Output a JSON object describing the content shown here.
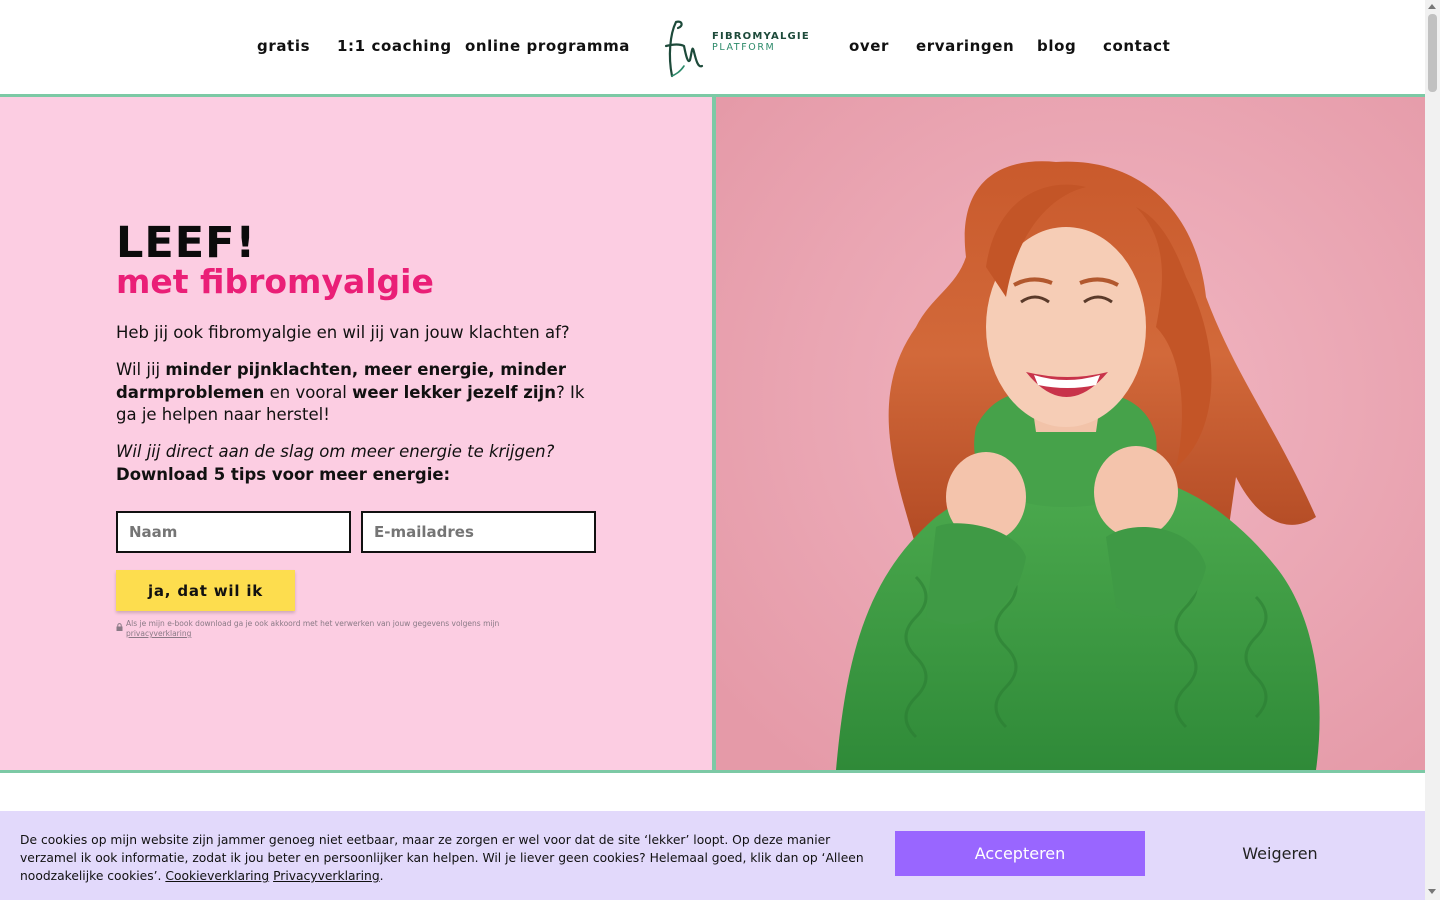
{
  "nav": {
    "left": [
      "gratis",
      "1:1 coaching",
      "online programma"
    ],
    "right": [
      "over",
      "ervaringen",
      "blog",
      "contact"
    ]
  },
  "logo": {
    "line1": "FIBROMYALGIE",
    "line2": "PLATFORM"
  },
  "hero": {
    "title": "LEEF!",
    "subtitle": "met fibromyalgie",
    "intro": "Heb jij ook fibromyalgie en wil jij van jouw klachten af?",
    "p2": {
      "a": "Wil jij ",
      "b": "minder pijnklachten, meer energie, minder darmproblemen",
      "c": " en vooral ",
      "d": "weer lekker jezelf zijn",
      "e": "? Ik ga je helpen naar herstel!"
    },
    "question": "Wil jij direct aan de slag om meer energie te krijgen?",
    "download": "Download 5 tips voor meer energie:"
  },
  "form": {
    "name_placeholder": "Naam",
    "email_placeholder": "E-mailadres",
    "button_label": "ja, dat wil ik",
    "legal_text": "Als je mijn e-book download ga je ook akkoord met het verwerken van jouw gegevens volgens mijn",
    "legal_link": "privacyverklaring"
  },
  "cookie": {
    "text": "De cookies op mijn website zijn jammer genoeg niet eetbaar, maar ze zorgen er wel voor dat de site ‘lekker’ loopt. Op deze manier verzamel ik ook informatie, zodat ik jou beter en persoonlijker kan helpen. Wil je liever geen cookies? Helemaal goed, klik dan op ‘Alleen noodzakelijke cookies’.",
    "link1": "Cookieverklaring",
    "link2": "Privacyverklaring",
    "accept_label": "Accepteren",
    "decline_label": "Weigeren"
  },
  "colors": {
    "hero_bg": "#fccde2",
    "accent_pink": "#ea1f77",
    "divider_green": "#7cc9a5",
    "cta_yellow": "#fddd4e",
    "cookie_bg": "#e2d9fb",
    "accept_purple": "#9966ff"
  },
  "icons": [
    "logo-mark",
    "lock-icon"
  ]
}
